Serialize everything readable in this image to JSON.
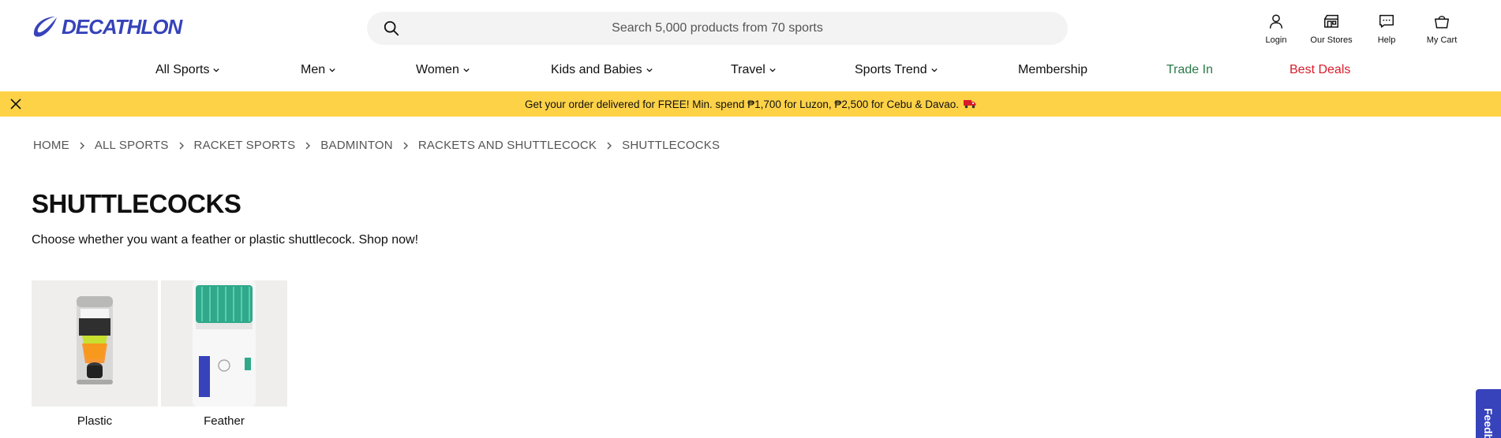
{
  "header": {
    "logo_text": "DECATHLON",
    "search_placeholder": "Search 5,000 products from 70 sports",
    "actions": [
      {
        "label": "Login",
        "icon": "user-icon"
      },
      {
        "label": "Our Stores",
        "icon": "store-icon"
      },
      {
        "label": "Help",
        "icon": "chat-icon"
      },
      {
        "label": "My Cart",
        "icon": "cart-icon"
      }
    ]
  },
  "nav": {
    "items": [
      {
        "label": "All Sports",
        "dropdown": true
      },
      {
        "label": "Men",
        "dropdown": true
      },
      {
        "label": "Women",
        "dropdown": true
      },
      {
        "label": "Kids and Babies",
        "dropdown": true
      },
      {
        "label": "Travel",
        "dropdown": true
      },
      {
        "label": "Sports Trend",
        "dropdown": true
      },
      {
        "label": "Membership",
        "dropdown": false
      },
      {
        "label": "Trade In",
        "dropdown": false,
        "color": "#2a7a48"
      },
      {
        "label": "Best Deals",
        "dropdown": false,
        "color": "#d81b2a"
      }
    ]
  },
  "banner": {
    "text": "Get your order delivered for FREE! Min. spend ₱1,700 for Luzon, ₱2,500 for Cebu & Davao.",
    "background": "#fed247"
  },
  "breadcrumb": [
    "HOME",
    "ALL SPORTS",
    "RACKET SPORTS",
    "BADMINTON",
    "RACKETS AND SHUTTLECOCK",
    "SHUTTLECOCKS"
  ],
  "page": {
    "title": "SHUTTLECOCKS",
    "description": "Choose whether you want a feather or plastic shuttlecock. Shop now!"
  },
  "categories": [
    {
      "label": "Plastic"
    },
    {
      "label": "Feather"
    }
  ],
  "feedback": {
    "label": "Feedback"
  },
  "colors": {
    "brand": "#3643ba",
    "banner": "#fed247",
    "trade_in": "#2a7a48",
    "best_deals": "#d81b2a"
  }
}
